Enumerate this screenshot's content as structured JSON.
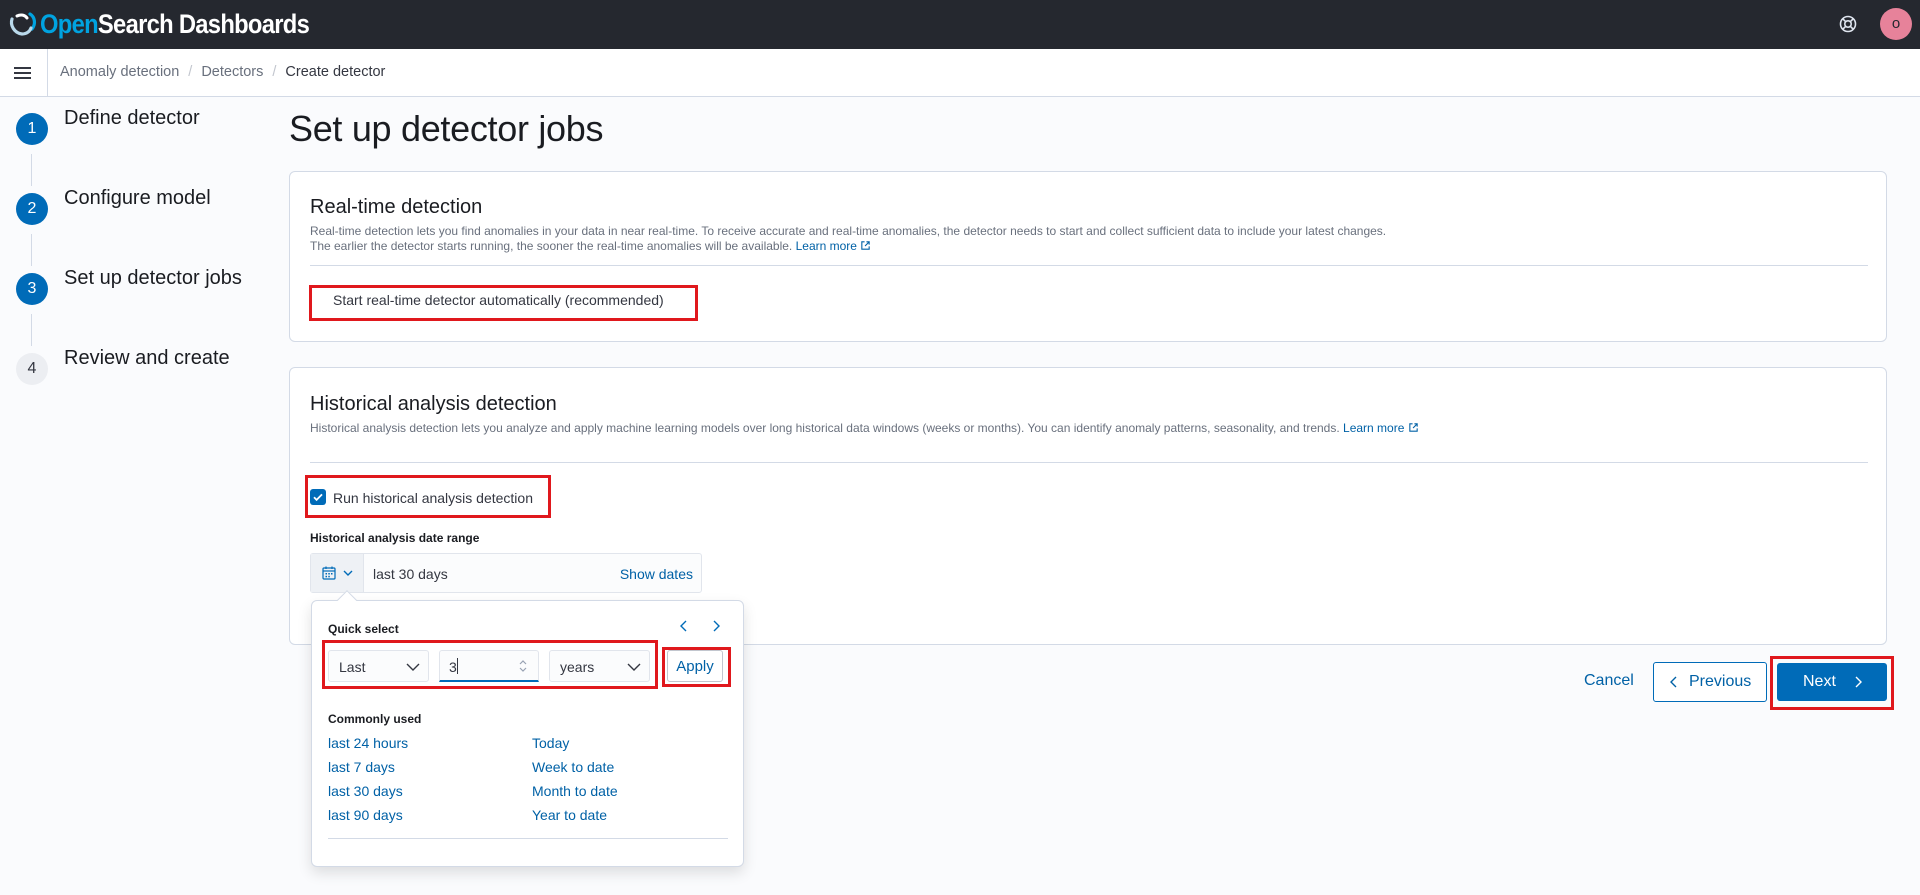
{
  "header": {
    "logo_open": "Open",
    "logo_rest": "Search Dashboards",
    "avatar_initial": "o"
  },
  "breadcrumb": [
    "Anomaly detection",
    "Detectors",
    "Create detector"
  ],
  "steps": [
    {
      "number": "1",
      "label": "Define detector",
      "state": "complete"
    },
    {
      "number": "2",
      "label": "Configure model",
      "state": "complete"
    },
    {
      "number": "3",
      "label": "Set up detector jobs",
      "state": "current"
    },
    {
      "number": "4",
      "label": "Review and create",
      "state": "incomplete"
    }
  ],
  "page_title": "Set up detector jobs",
  "realtime": {
    "title": "Real-time detection",
    "desc_line1": "Real-time detection lets you find anomalies in your data in near real-time. To receive accurate and real-time anomalies, the detector needs to start and collect sufficient data to include your latest changes.",
    "desc_line2": "The earlier the detector starts running, the sooner the real-time anomalies will be available.",
    "learn_more": "Learn more",
    "checkbox_label": "Start real-time detector automatically (recommended)",
    "checked": false
  },
  "historical": {
    "title": "Historical analysis detection",
    "desc": "Historical analysis detection lets you analyze and apply machine learning models over long historical data windows (weeks or months). You can identify anomaly patterns, seasonality, and trends.",
    "learn_more": "Learn more",
    "checkbox_label": "Run historical analysis detection",
    "checked": true,
    "date_range_label": "Historical analysis date range",
    "date_range_value": "last 30 days",
    "show_dates": "Show dates"
  },
  "quick_select": {
    "title": "Quick select",
    "tense": "Last",
    "value": "3",
    "unit": "years",
    "apply": "Apply",
    "commonly_used_title": "Commonly used",
    "commonly_used": [
      "last 24 hours",
      "Today",
      "last 7 days",
      "Week to date",
      "last 30 days",
      "Month to date",
      "last 90 days",
      "Year to date"
    ]
  },
  "footer": {
    "cancel": "Cancel",
    "previous": "Previous",
    "next": "Next"
  },
  "colors": {
    "primary": "#006bb8",
    "link": "#0061a6",
    "header_bg": "#25282f",
    "highlight": "#e0181d"
  }
}
